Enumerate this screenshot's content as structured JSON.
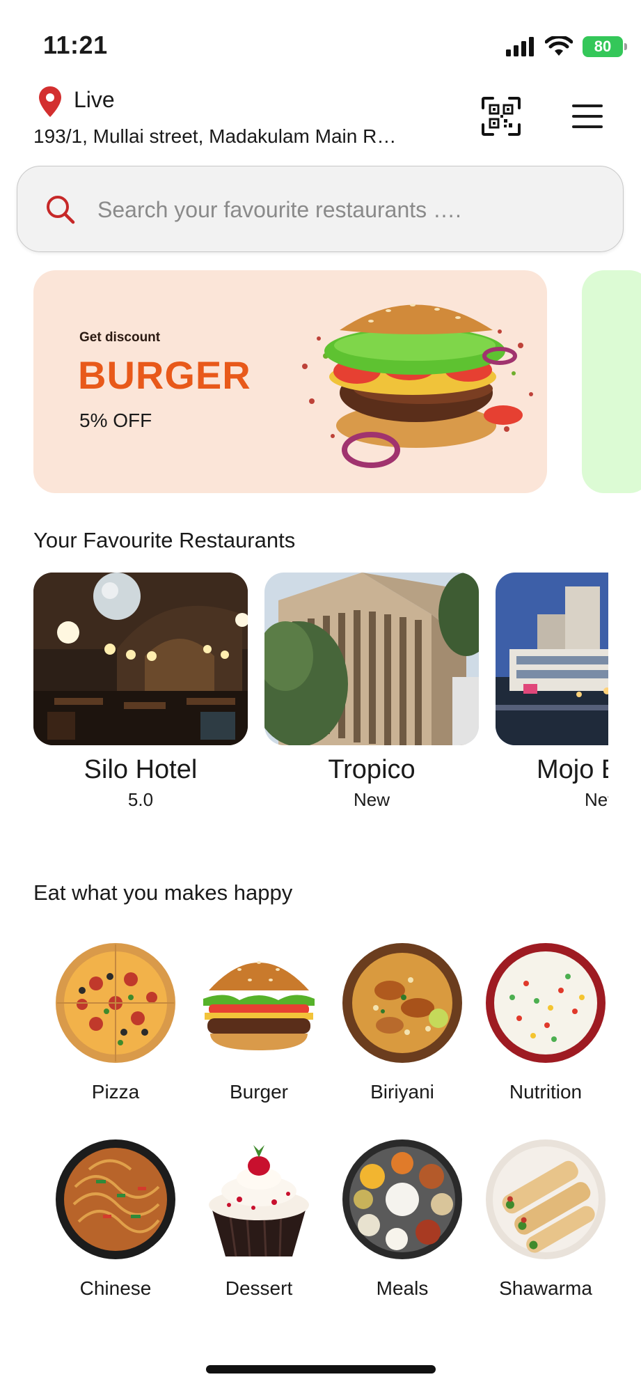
{
  "status_bar": {
    "time": "11:21",
    "battery": "80"
  },
  "header": {
    "location_label": "Live",
    "address": "193/1, Mullai street, Madakulam Main R…"
  },
  "search": {
    "placeholder": "Search your favourite restaurants …."
  },
  "promo": {
    "eyebrow": "Get discount",
    "title": "BURGER",
    "discount": "5% OFF",
    "accent_color": "#e8591a",
    "background_color": "#fbe5d8",
    "next_card_color": "#dcfbd4"
  },
  "favourites": {
    "title": "Your Favourite Restaurants",
    "items": [
      {
        "name": "Silo Hotel",
        "rating": "5.0",
        "image": "restaurant-interior"
      },
      {
        "name": "Tropico",
        "rating": "New",
        "image": "hotel-building"
      },
      {
        "name": "Mojo Bistro",
        "rating": "New",
        "image": "city-street"
      }
    ]
  },
  "categories": {
    "title": "Eat what you makes happy",
    "items": [
      {
        "label": "Pizza"
      },
      {
        "label": "Burger"
      },
      {
        "label": "Biriyani"
      },
      {
        "label": "Nutrition"
      },
      {
        "label": "Chinese"
      },
      {
        "label": "Dessert"
      },
      {
        "label": "Meals"
      },
      {
        "label": "Shawarma"
      }
    ]
  },
  "theme": {
    "pin_color": "#d32f2f",
    "search_icon_color": "#c62828"
  }
}
